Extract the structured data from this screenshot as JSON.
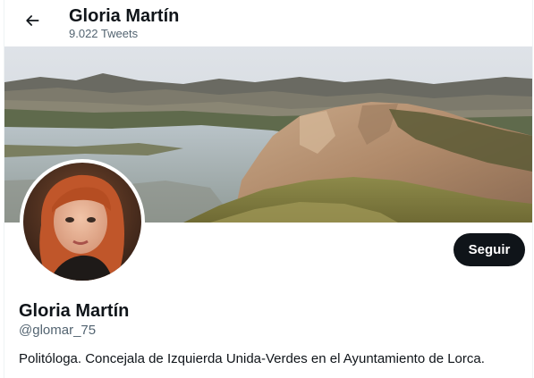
{
  "header": {
    "title": "Gloria Martín",
    "tweet_count": "9.022 Tweets",
    "back_icon": "arrow-left-icon"
  },
  "banner": {
    "description_icon": "landscape-photo"
  },
  "profile": {
    "display_name": "Gloria Martín",
    "handle": "@glomar_75",
    "bio": "Politóloga. Concejala de Izquierda Unida-Verdes en el Ayuntamiento de Lorca.",
    "follow_label": "Seguir"
  },
  "colors": {
    "text_primary": "#0f1419",
    "text_secondary": "#536471",
    "button_bg": "#0f1419",
    "button_text": "#ffffff"
  }
}
